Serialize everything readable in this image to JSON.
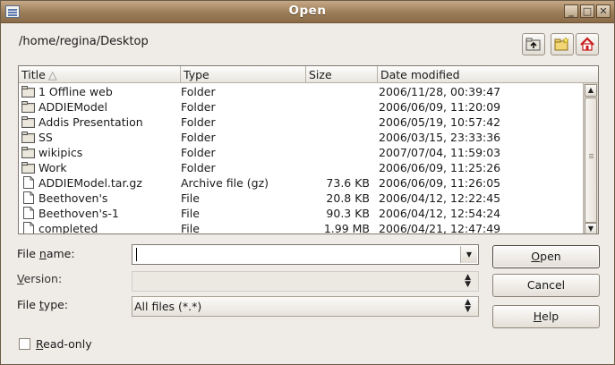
{
  "window": {
    "title": "Open",
    "controls": {
      "minimize": "_",
      "maximize": "□",
      "close": "✕"
    }
  },
  "toolbar": {
    "path": "/home/regina/Desktop",
    "buttons": [
      "up-folder-icon",
      "new-folder-icon",
      "home-icon"
    ]
  },
  "file_list": {
    "columns": [
      "Title",
      "Type",
      "Size",
      "Date modified"
    ],
    "sort_indicator": "△",
    "rows": [
      {
        "name": "1 Offline web",
        "type": "Folder",
        "size": "",
        "date": "2006/11/28, 00:39:47",
        "icon": "folder-icon"
      },
      {
        "name": "ADDIEModel",
        "type": "Folder",
        "size": "",
        "date": "2006/06/09, 11:20:09",
        "icon": "folder-icon"
      },
      {
        "name": "Addis Presentation",
        "type": "Folder",
        "size": "",
        "date": "2006/05/19, 10:57:42",
        "icon": "folder-icon"
      },
      {
        "name": "SS",
        "type": "Folder",
        "size": "",
        "date": "2006/03/15, 23:33:36",
        "icon": "folder-icon"
      },
      {
        "name": "wikipics",
        "type": "Folder",
        "size": "",
        "date": "2007/07/04, 11:59:03",
        "icon": "folder-icon"
      },
      {
        "name": "Work",
        "type": "Folder",
        "size": "",
        "date": "2006/06/09, 11:25:26",
        "icon": "folder-icon"
      },
      {
        "name": "ADDIEModel.tar.gz",
        "type": "Archive file (gz)",
        "size": "73.6 KB",
        "date": "2006/06/09, 11:26:05",
        "icon": "file-icon"
      },
      {
        "name": "Beethoven's",
        "type": "File",
        "size": "20.8 KB",
        "date": "2006/04/12, 12:22:45",
        "icon": "file-icon"
      },
      {
        "name": "Beethoven's-1",
        "type": "File",
        "size": "90.3 KB",
        "date": "2006/04/12, 12:54:24",
        "icon": "file-icon"
      },
      {
        "name": "completed",
        "type": "File",
        "size": "1.99 MB",
        "date": "2006/04/21, 12:47:49",
        "icon": "file-icon"
      }
    ]
  },
  "form": {
    "file_name_label_pre": "File ",
    "file_name_label_ul": "n",
    "file_name_label_post": "ame:",
    "file_name_value": "",
    "version_label_ul": "V",
    "version_label_post": "ersion:",
    "version_value": "",
    "file_type_label_pre": "File ",
    "file_type_label_ul": "t",
    "file_type_label_post": "ype:",
    "file_type_value": "All files (*.*)",
    "read_only_label_ul": "R",
    "read_only_label_post": "ead-only",
    "read_only_checked": false
  },
  "buttons": {
    "open_ul": "O",
    "open_post": "pen",
    "cancel": "Cancel",
    "help_ul": "H",
    "help_post": "elp"
  }
}
